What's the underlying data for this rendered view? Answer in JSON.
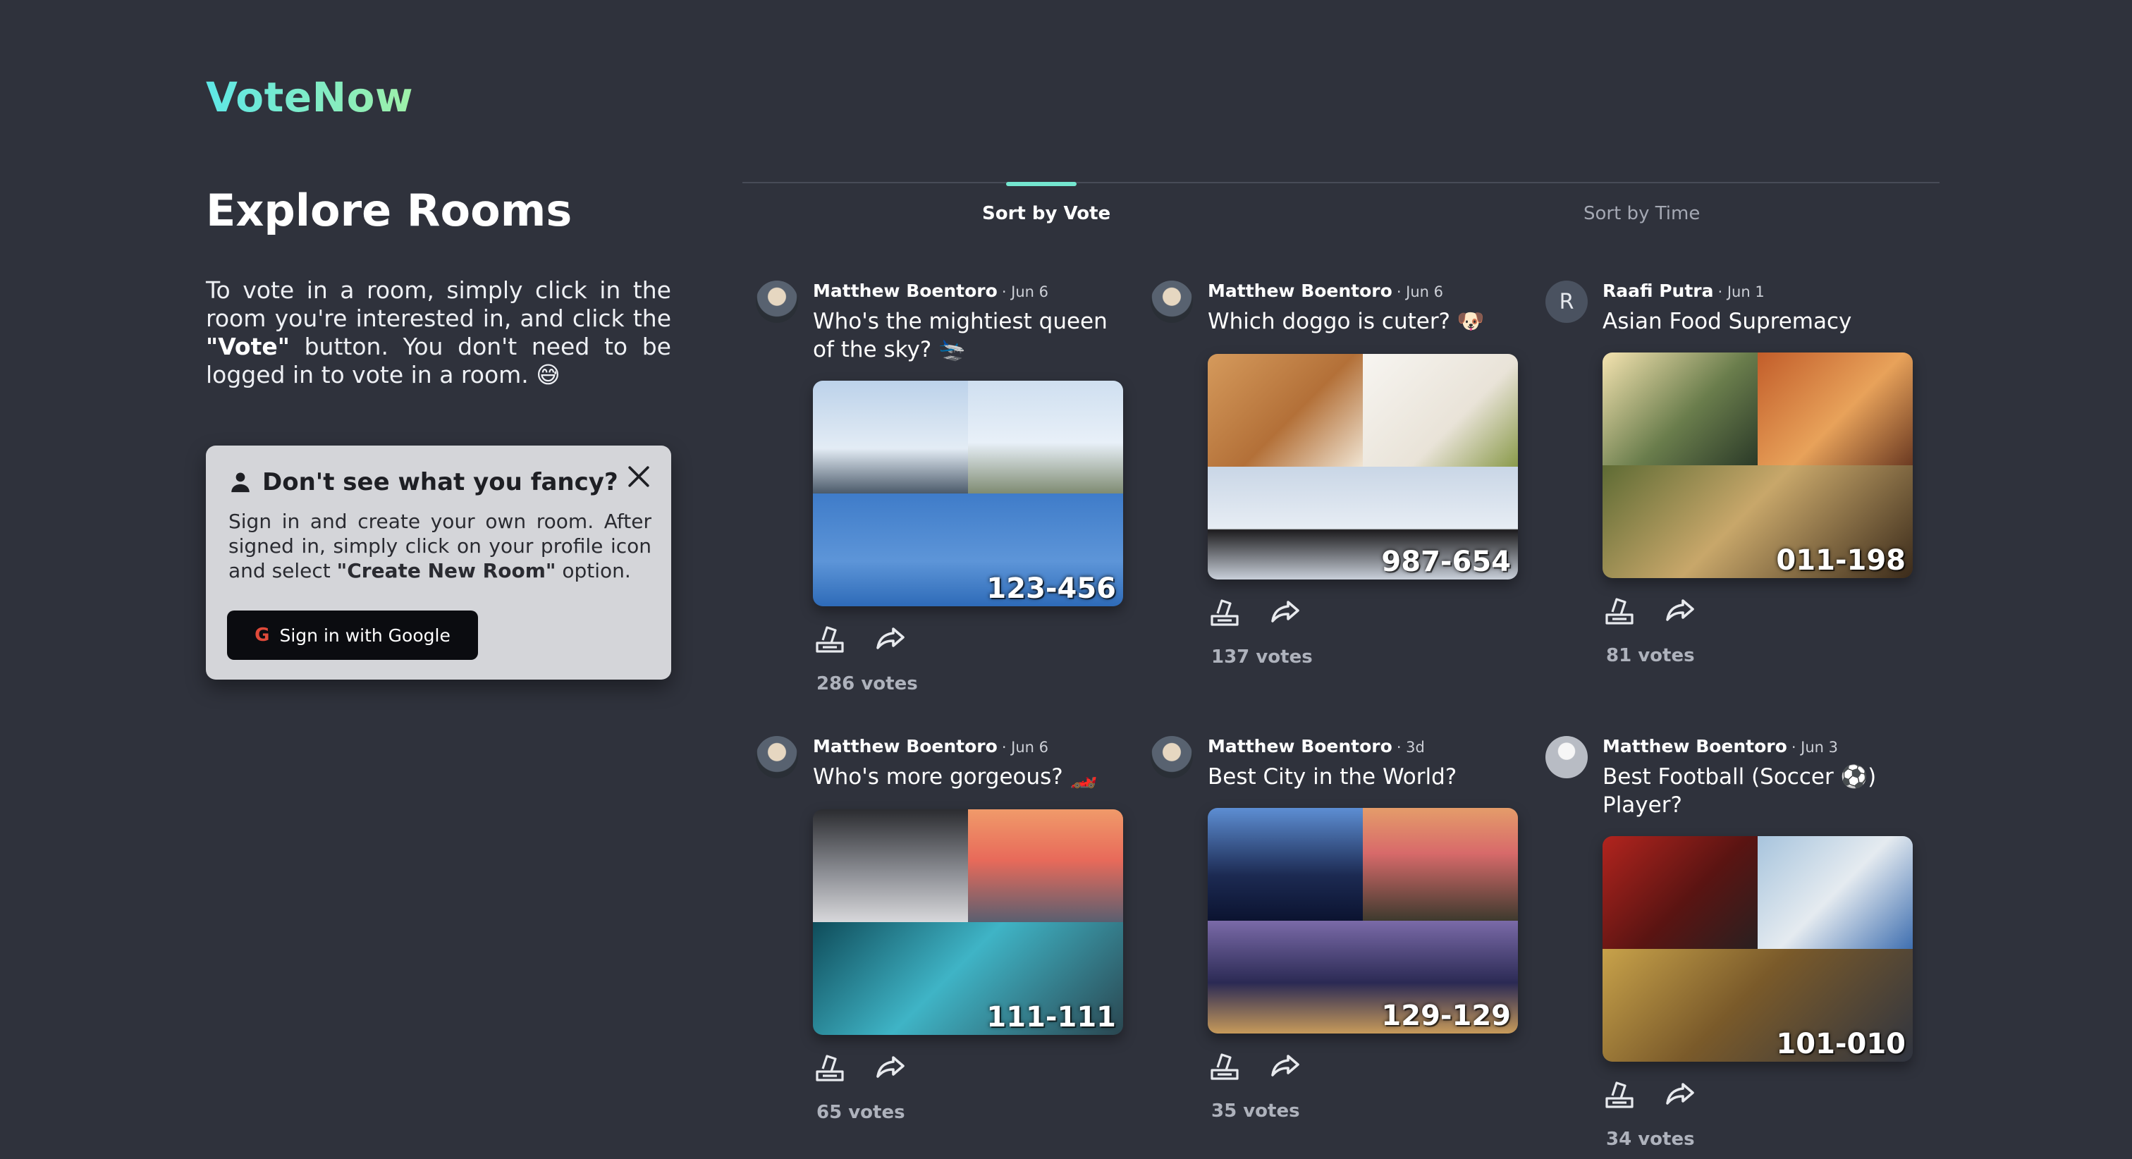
{
  "app": {
    "logo": "VoteNow"
  },
  "page": {
    "title": "Explore Rooms",
    "intro_part1": "To vote in a room, simply click in the room you're interested in, and click the ",
    "intro_bold": "\"Vote\"",
    "intro_part2": " button. You don't need to be logged in to vote in a room. ",
    "intro_emoji": "😅"
  },
  "fancy_box": {
    "title": "Don't see what you fancy?",
    "text_part1": "Sign in and create your own room. After signed in, simply click on your profile icon and select ",
    "text_bold": "\"Create New Room\"",
    "text_part2": " option.",
    "google_button": "Sign in with Google",
    "google_glyph": "G",
    "icons": {
      "person": "person-icon",
      "close": "close-icon",
      "google": "google-icon"
    }
  },
  "tabs": [
    {
      "label": "Sort by Vote",
      "active": true
    },
    {
      "label": "Sort by Time",
      "active": false
    }
  ],
  "colors": {
    "background": "#2f323c",
    "accent": "#74e6cf",
    "logo_gradient": [
      "#5ee7e7",
      "#9ff0a8"
    ]
  },
  "rooms": [
    {
      "author": "Matthew Boentoro",
      "date": "· Jun 6",
      "question": "Who's the mightiest queen of the sky? 🛬",
      "code": "123-456",
      "votes": "286 votes",
      "avatar_type": "photo",
      "avatar_letter": ""
    },
    {
      "author": "Matthew Boentoro",
      "date": "· Jun 6",
      "question": "Which doggo is cuter? 🐶",
      "code": "987-654",
      "votes": "137 votes",
      "avatar_type": "photo",
      "avatar_letter": ""
    },
    {
      "author": "Raafi Putra",
      "date": "· Jun 1",
      "question": "Asian Food Supremacy",
      "code": "011-198",
      "votes": "81 votes",
      "avatar_type": "letter",
      "avatar_letter": "R"
    },
    {
      "author": "Matthew Boentoro",
      "date": "· Jun 6",
      "question": "Who's more gorgeous? 🏎️",
      "code": "111-111",
      "votes": "65 votes",
      "avatar_type": "photo",
      "avatar_letter": ""
    },
    {
      "author": "Matthew Boentoro",
      "date": "· 3d",
      "question": "Best City in the World?",
      "code": "129-129",
      "votes": "35 votes",
      "avatar_type": "photo",
      "avatar_letter": ""
    },
    {
      "author": "Matthew Boentoro",
      "date": "· Jun 3",
      "question": "Best Football (Soccer ⚽) Player?",
      "code": "101-010",
      "votes": "34 votes",
      "avatar_type": "blank",
      "avatar_letter": ""
    }
  ],
  "room_icons": {
    "vote": "vote-icon",
    "share": "share-icon"
  }
}
